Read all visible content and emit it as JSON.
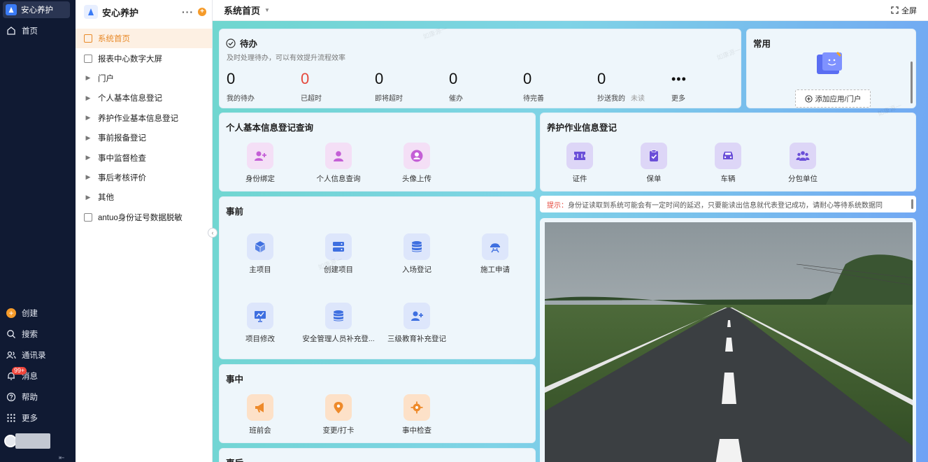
{
  "rail": {
    "brand": "安心养护",
    "home": "首页",
    "create": "创建",
    "search": "搜索",
    "contacts": "通讯录",
    "messages": "消息",
    "messages_badge": "99+",
    "help": "帮助",
    "more": "更多"
  },
  "sidebar": {
    "title": "安心养护",
    "items": [
      {
        "label": "系统首页",
        "type": "page",
        "active": true
      },
      {
        "label": "报表中心数字大屏",
        "type": "page"
      },
      {
        "label": "门户",
        "type": "group"
      },
      {
        "label": "个人基本信息登记",
        "type": "group"
      },
      {
        "label": "养护作业基本信息登记",
        "type": "group"
      },
      {
        "label": "事前报备登记",
        "type": "group"
      },
      {
        "label": "事中监督检查",
        "type": "group"
      },
      {
        "label": "事后考核评价",
        "type": "group"
      },
      {
        "label": "其他",
        "type": "group"
      },
      {
        "label": "antuo身份证号数据脱敏",
        "type": "doc"
      }
    ]
  },
  "topbar": {
    "title": "系统首页",
    "fullscreen": "全屏"
  },
  "todo": {
    "title": "待办",
    "subtitle": "及时处理待办，可以有效提升流程效率",
    "stats": [
      {
        "value": "0",
        "label": "我的待办"
      },
      {
        "value": "0",
        "label": "已超时",
        "alert": true
      },
      {
        "value": "0",
        "label": "即将超时"
      },
      {
        "value": "0",
        "label": "催办"
      },
      {
        "value": "0",
        "label": "待完善"
      },
      {
        "value": "0",
        "label": "抄送我的",
        "extra": "未读"
      }
    ],
    "more_label": "更多"
  },
  "common": {
    "title": "常用",
    "add_button": "添加应用/门户"
  },
  "personal": {
    "title": "个人基本信息登记查询",
    "apps": [
      {
        "label": "身份绑定",
        "icon": "user-plus-icon"
      },
      {
        "label": "个人信息查询",
        "icon": "user-icon"
      },
      {
        "label": "头像上传",
        "icon": "user-circle-icon"
      }
    ]
  },
  "maintenance": {
    "title": "养护作业信息登记",
    "apps": [
      {
        "label": "证件",
        "icon": "ticket-icon"
      },
      {
        "label": "保单",
        "icon": "clipboard-check-icon"
      },
      {
        "label": "车辆",
        "icon": "car-icon"
      },
      {
        "label": "分包单位",
        "icon": "team-icon"
      }
    ]
  },
  "before": {
    "title": "事前",
    "apps": [
      {
        "label": "主项目",
        "icon": "cube-icon"
      },
      {
        "label": "创建项目",
        "icon": "server-icon"
      },
      {
        "label": "入场登记",
        "icon": "database-icon"
      },
      {
        "label": "施工申请",
        "icon": "worker-icon"
      },
      {
        "label": "项目修改",
        "icon": "presentation-icon"
      },
      {
        "label": "安全管理人员补充登...",
        "icon": "database-icon"
      },
      {
        "label": "三级教育补充登记",
        "icon": "user-plus-icon"
      }
    ]
  },
  "during": {
    "title": "事中",
    "apps": [
      {
        "label": "班前会",
        "icon": "megaphone-icon"
      },
      {
        "label": "变更/打卡",
        "icon": "location-pin-icon"
      },
      {
        "label": "事中检查",
        "icon": "target-icon"
      }
    ]
  },
  "after": {
    "title": "事后"
  },
  "hint": {
    "prefix": "提示：",
    "text": "身份证读取到系统可能会有一定时间的延迟，只要能读出信息就代表登记成功，请耐心等待系统数据同"
  },
  "colors": {
    "accent_orange": "#e88a2a",
    "alert_red": "#e5483c",
    "rail_bg": "#101a33"
  }
}
